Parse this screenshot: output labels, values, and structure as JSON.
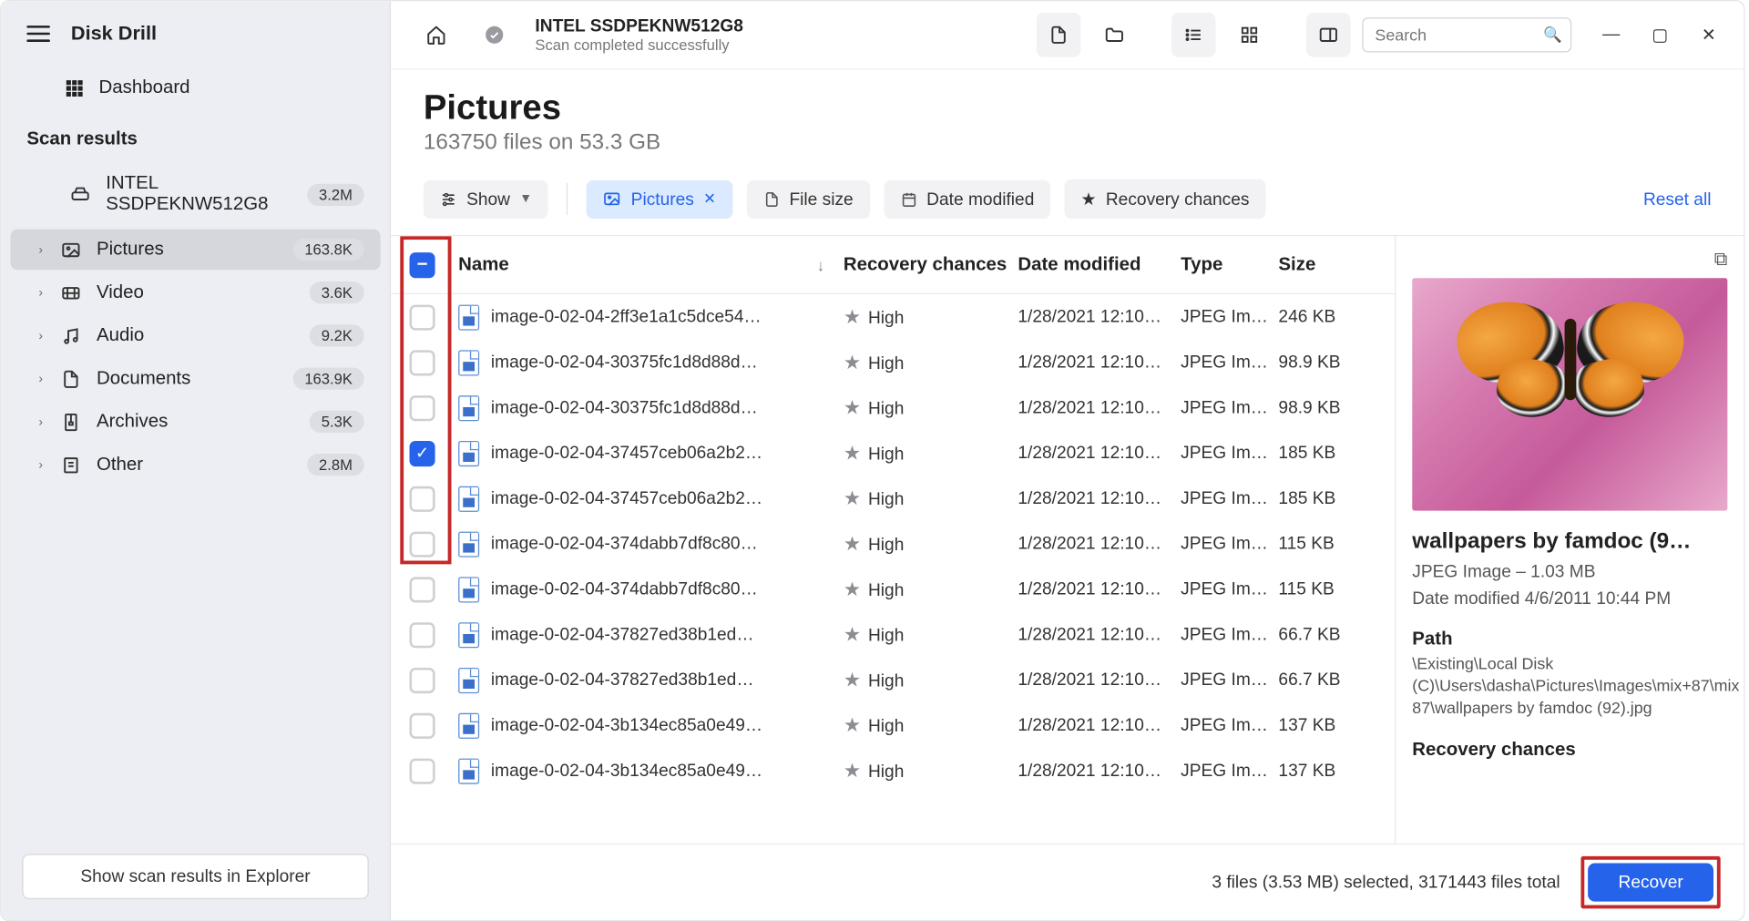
{
  "app": {
    "title": "Disk Drill"
  },
  "sidebar": {
    "dashboard": "Dashboard",
    "section": "Scan results",
    "drive": {
      "label": "INTEL SSDPEKNW512G8",
      "badge": "3.2M"
    },
    "items": [
      {
        "label": "Pictures",
        "badge": "163.8K"
      },
      {
        "label": "Video",
        "badge": "3.6K"
      },
      {
        "label": "Audio",
        "badge": "9.2K"
      },
      {
        "label": "Documents",
        "badge": "163.9K"
      },
      {
        "label": "Archives",
        "badge": "5.3K"
      },
      {
        "label": "Other",
        "badge": "2.8M"
      }
    ],
    "explorer_btn": "Show scan results in Explorer"
  },
  "topbar": {
    "drive_title": "INTEL SSDPEKNW512G8",
    "status": "Scan completed successfully",
    "search_placeholder": "Search"
  },
  "heading": {
    "title": "Pictures",
    "subtitle": "163750 files on 53.3 GB"
  },
  "filters": {
    "show": "Show",
    "chips": [
      {
        "label": "Pictures"
      },
      {
        "label": "File size"
      },
      {
        "label": "Date modified"
      },
      {
        "label": "Recovery chances"
      }
    ],
    "reset": "Reset all"
  },
  "columns": {
    "name": "Name",
    "rec": "Recovery chances",
    "date": "Date modified",
    "type": "Type",
    "size": "Size"
  },
  "rows": [
    {
      "checked": false,
      "name": "image-0-02-04-2ff3e1a1c5dce54…",
      "rec": "High",
      "date": "1/28/2021 12:10…",
      "type": "JPEG Im…",
      "size": "246 KB"
    },
    {
      "checked": false,
      "name": "image-0-02-04-30375fc1d8d88d…",
      "rec": "High",
      "date": "1/28/2021 12:10…",
      "type": "JPEG Im…",
      "size": "98.9 KB"
    },
    {
      "checked": false,
      "name": "image-0-02-04-30375fc1d8d88d…",
      "rec": "High",
      "date": "1/28/2021 12:10…",
      "type": "JPEG Im…",
      "size": "98.9 KB"
    },
    {
      "checked": true,
      "name": "image-0-02-04-37457ceb06a2b2…",
      "rec": "High",
      "date": "1/28/2021 12:10…",
      "type": "JPEG Im…",
      "size": "185 KB"
    },
    {
      "checked": false,
      "name": "image-0-02-04-37457ceb06a2b2…",
      "rec": "High",
      "date": "1/28/2021 12:10…",
      "type": "JPEG Im…",
      "size": "185 KB"
    },
    {
      "checked": false,
      "name": "image-0-02-04-374dabb7df8c80…",
      "rec": "High",
      "date": "1/28/2021 12:10…",
      "type": "JPEG Im…",
      "size": "115 KB"
    },
    {
      "checked": false,
      "name": "image-0-02-04-374dabb7df8c80…",
      "rec": "High",
      "date": "1/28/2021 12:10…",
      "type": "JPEG Im…",
      "size": "115 KB"
    },
    {
      "checked": false,
      "name": "image-0-02-04-37827ed38b1ed…",
      "rec": "High",
      "date": "1/28/2021 12:10…",
      "type": "JPEG Im…",
      "size": "66.7 KB"
    },
    {
      "checked": false,
      "name": "image-0-02-04-37827ed38b1ed…",
      "rec": "High",
      "date": "1/28/2021 12:10…",
      "type": "JPEG Im…",
      "size": "66.7 KB"
    },
    {
      "checked": false,
      "name": "image-0-02-04-3b134ec85a0e49…",
      "rec": "High",
      "date": "1/28/2021 12:10…",
      "type": "JPEG Im…",
      "size": "137 KB"
    },
    {
      "checked": false,
      "name": "image-0-02-04-3b134ec85a0e49…",
      "rec": "High",
      "date": "1/28/2021 12:10…",
      "type": "JPEG Im…",
      "size": "137 KB"
    }
  ],
  "preview": {
    "title": "wallpapers by famdoc (9…",
    "meta1": "JPEG Image – 1.03 MB",
    "meta2": "Date modified 4/6/2011 10:44 PM",
    "path_label": "Path",
    "path": "\\Existing\\Local Disk (C)\\Users\\dasha\\Pictures\\Images\\mix+87\\mix 87\\wallpapers by famdoc (92).jpg",
    "rec_label": "Recovery chances"
  },
  "bottom": {
    "status": "3 files (3.53 MB) selected, 3171443 files total",
    "recover": "Recover"
  }
}
